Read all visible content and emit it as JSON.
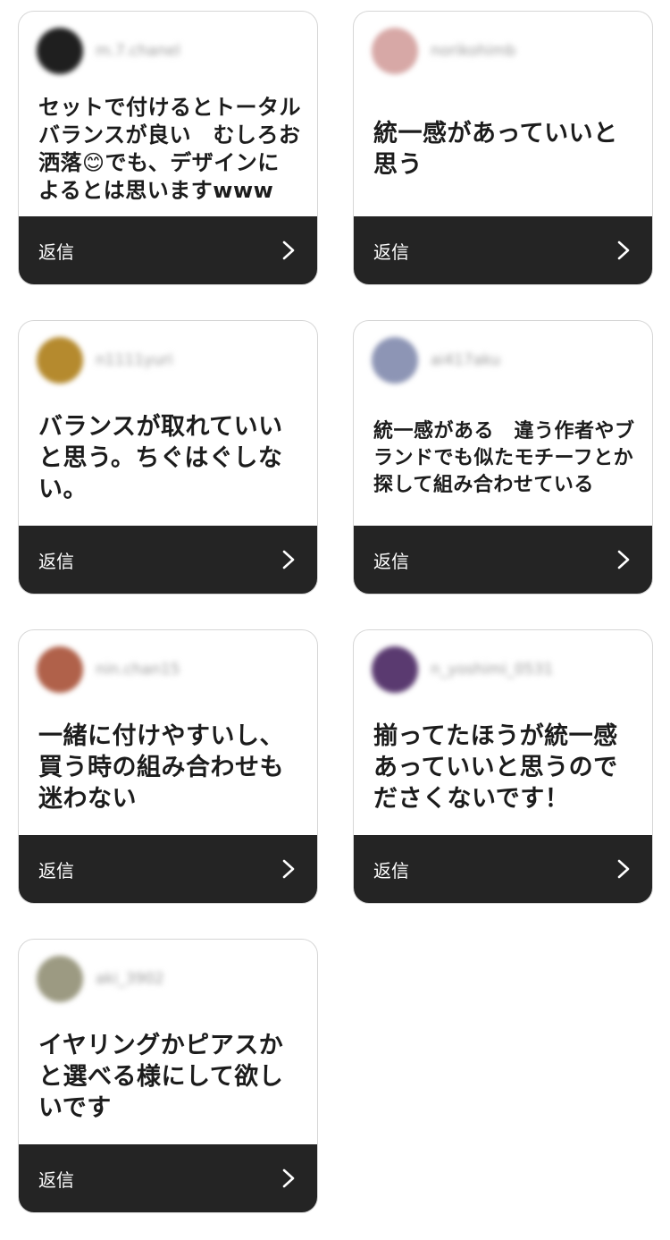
{
  "reply_label": "返信",
  "cards": [
    {
      "username": "m.7.chanel",
      "avatar_color": "#1f1f1f",
      "comment": "セットで付けるとトータルバランスが良い　むしろお洒落😊でも、デザインによるとは思いますwww"
    },
    {
      "username": "norikohimb",
      "avatar_color": "#d7a8a6",
      "comment": "統一感があっていいと思う"
    },
    {
      "username": "n1111yuri",
      "avatar_color": "#b58a2e",
      "comment": "バランスが取れていいと思う。ちぐはぐしない。"
    },
    {
      "username": "ai417aku",
      "avatar_color": "#8d95b5",
      "comment": "統一感がある　違う作者やブランドでも似たモチーフとか探して組み合わせている"
    },
    {
      "username": "nin.chan15",
      "avatar_color": "#b0614a",
      "comment": "一緒に付けやすいし、買う時の組み合わせも迷わない"
    },
    {
      "username": "n_yoshimi_0531",
      "avatar_color": "#5a3a70",
      "comment": "揃ってたほうが統一感あっていいと思うのでださくないです！"
    },
    {
      "username": "aki_3902",
      "avatar_color": "#9c9a82",
      "comment": "イヤリングかピアスかと選べる様にして欲しいです"
    }
  ]
}
